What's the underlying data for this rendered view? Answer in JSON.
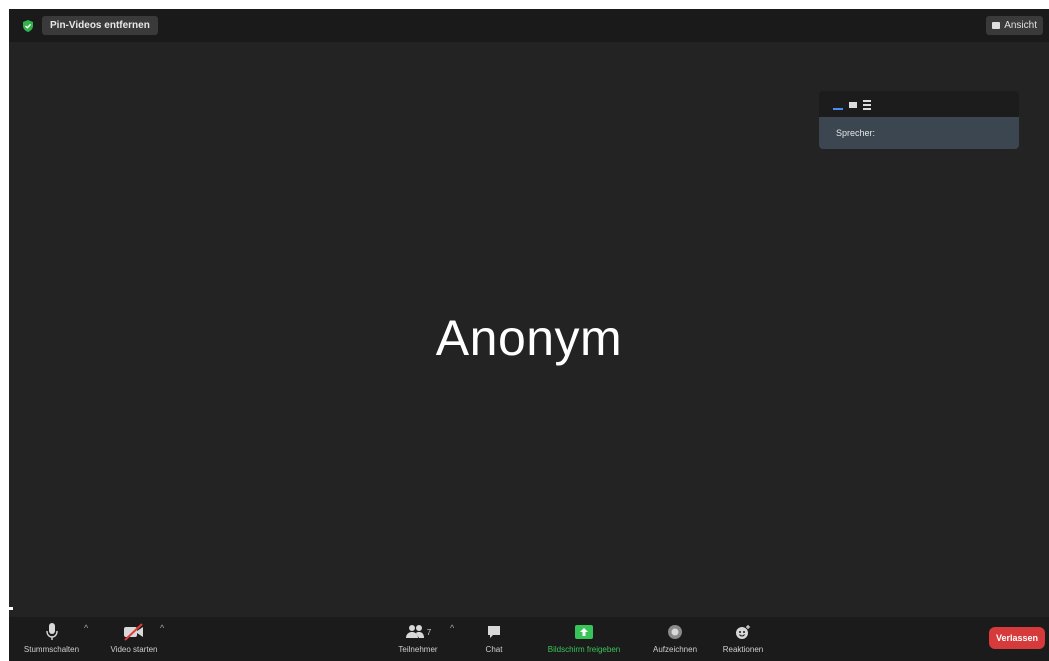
{
  "topbar": {
    "pin_label": "Pin-Videos entfernen",
    "view_label": "Ansicht"
  },
  "main": {
    "speaker_name": "Anonym"
  },
  "view_panel": {
    "option_label": "Sprecher:"
  },
  "toolbar": {
    "mute_label": "Stummschalten",
    "video_label": "Video starten",
    "participants_label": "Teilnehmer",
    "participants_count": "7",
    "chat_label": "Chat",
    "share_label": "Bildschirm freigeben",
    "record_label": "Aufzeichnen",
    "reactions_label": "Reaktionen",
    "leave_label": "Verlassen"
  },
  "colors": {
    "background": "#232323",
    "share_green": "#39c45a",
    "leave_red": "#d63a3a",
    "panel_highlight": "#3b4650"
  }
}
